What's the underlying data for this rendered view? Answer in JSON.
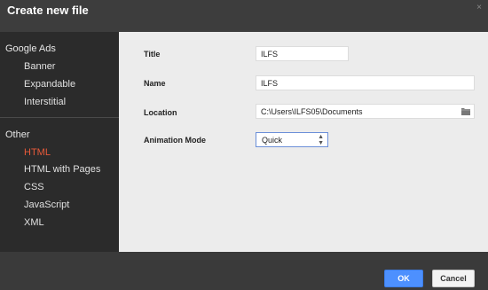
{
  "dialog": {
    "title": "Create new file",
    "close_label": "×"
  },
  "sidebar": {
    "categories": [
      {
        "label": "Google Ads",
        "items": [
          "Banner",
          "Expandable",
          "Interstitial"
        ]
      },
      {
        "label": "Other",
        "items": [
          "HTML",
          "HTML with Pages",
          "CSS",
          "JavaScript",
          "XML"
        ]
      }
    ],
    "selected": "HTML"
  },
  "form": {
    "title_label": "Title",
    "title_value": "ILFS",
    "name_label": "Name",
    "name_value": "ILFS",
    "location_label": "Location",
    "location_value": "C:\\Users\\ILFS05\\Documents",
    "animation_label": "Animation Mode",
    "animation_value": "Quick"
  },
  "footer": {
    "ok_label": "OK",
    "cancel_label": "Cancel"
  },
  "colors": {
    "primary_button": "#4d90fe",
    "selected_item": "#e85a3a",
    "sidebar_bg": "#2b2b2b",
    "panel_bg": "#ececec"
  },
  "icons": {
    "folder": "folder-icon",
    "close": "close-icon",
    "spinner": "spinner-arrows-icon"
  }
}
